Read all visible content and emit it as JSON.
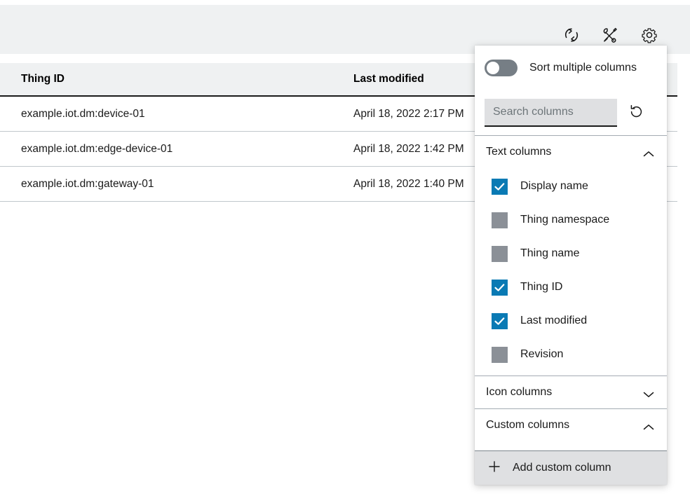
{
  "toolbar": {
    "buttons": [
      {
        "name": "refresh",
        "icon": "refresh-icon",
        "title": "Refresh"
      },
      {
        "name": "tools",
        "icon": "tools-icon",
        "title": "Tools"
      },
      {
        "name": "settings",
        "icon": "gear-icon",
        "title": "Settings"
      }
    ]
  },
  "table": {
    "columns": [
      {
        "key": "thing_id",
        "label": "Thing ID"
      },
      {
        "key": "last_modified",
        "label": "Last modified"
      }
    ],
    "rows": [
      {
        "thing_id": "example.iot.dm:device-01",
        "last_modified": "April 18, 2022 2:17 PM"
      },
      {
        "thing_id": "example.iot.dm:edge-device-01",
        "last_modified": "April 18, 2022 1:42 PM"
      },
      {
        "thing_id": "example.iot.dm:gateway-01",
        "last_modified": "April 18, 2022 1:40 PM"
      }
    ]
  },
  "column_panel": {
    "sort_toggle": {
      "label": "Sort multiple columns",
      "state": "off"
    },
    "search": {
      "placeholder": "Search columns",
      "value": ""
    },
    "reset_button": {
      "icon": "reset-icon",
      "title": "Reset"
    },
    "sections": [
      {
        "id": "text-columns",
        "label": "Text columns",
        "expanded": true,
        "chevron": "chevron-up-icon",
        "items": [
          {
            "label": "Display name",
            "checked": true
          },
          {
            "label": "Thing namespace",
            "checked": false
          },
          {
            "label": "Thing name",
            "checked": false
          },
          {
            "label": "Thing ID",
            "checked": true
          },
          {
            "label": "Last modified",
            "checked": true
          },
          {
            "label": "Revision",
            "checked": false
          }
        ]
      },
      {
        "id": "icon-columns",
        "label": "Icon columns",
        "expanded": false,
        "chevron": "chevron-down-icon",
        "items": []
      },
      {
        "id": "custom-columns",
        "label": "Custom columns",
        "expanded": true,
        "chevron": "chevron-up-icon",
        "items": []
      }
    ],
    "footer": {
      "label": "Add custom column",
      "icon": "plus-icon"
    }
  },
  "colors": {
    "accent_blue": "#0a7ab4",
    "checkbox_unchecked": "#8b9097",
    "toolbar_bg": "#eff1f2",
    "input_bg": "#dfe0e2",
    "toggle_off": "#767e85"
  }
}
